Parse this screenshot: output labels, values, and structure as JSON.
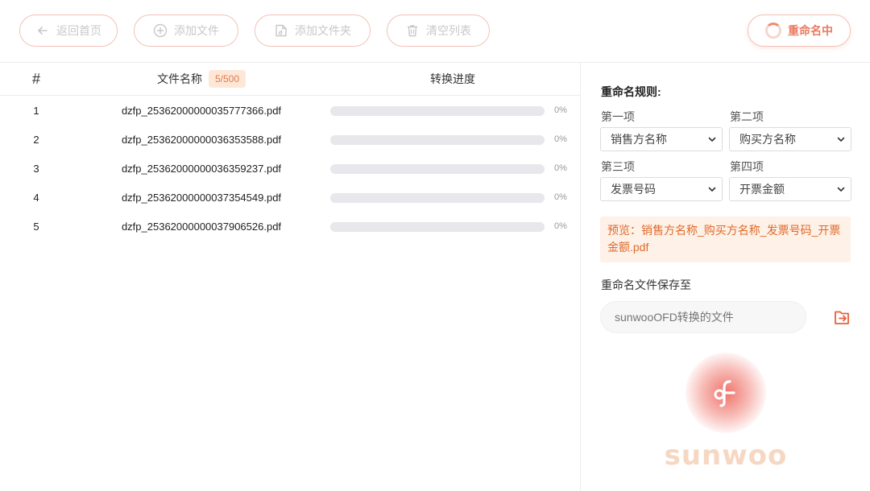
{
  "toolbar": {
    "back_label": "返回首页",
    "add_file_label": "添加文件",
    "add_folder_label": "添加文件夹",
    "clear_label": "清空列表",
    "rename_label": "重命名中"
  },
  "table": {
    "col_index": "#",
    "col_name": "文件名称",
    "count_badge": "5/500",
    "col_progress": "转换进度",
    "rows": [
      {
        "index": "1",
        "name": "dzfp_25362000000035777366.pdf",
        "progress": 0,
        "progress_text": "0%"
      },
      {
        "index": "2",
        "name": "dzfp_25362000000036353588.pdf",
        "progress": 0,
        "progress_text": "0%"
      },
      {
        "index": "3",
        "name": "dzfp_25362000000036359237.pdf",
        "progress": 0,
        "progress_text": "0%"
      },
      {
        "index": "4",
        "name": "dzfp_25362000000037354549.pdf",
        "progress": 0,
        "progress_text": "0%"
      },
      {
        "index": "5",
        "name": "dzfp_25362000000037906526.pdf",
        "progress": 0,
        "progress_text": "0%"
      }
    ]
  },
  "rules": {
    "title": "重命名规则:",
    "item1_label": "第一项",
    "item1_value": "销售方名称",
    "item2_label": "第二项",
    "item2_value": "购买方名称",
    "item3_label": "第三项",
    "item3_value": "发票号码",
    "item4_label": "第四项",
    "item4_value": "开票金额",
    "preview": "预览：销售方名称_购买方名称_发票号码_开票金额.pdf"
  },
  "save": {
    "label": "重命名文件保存至",
    "placeholder": "sunwooOFD转换的文件"
  },
  "brand": {
    "logo_text": "sunwoo"
  },
  "colors": {
    "accent": "#ea7a5f",
    "preview_bg": "#fdf1e8",
    "preview_text": "#e06a2a",
    "badge_bg": "#fde8d8",
    "progress_track": "#e7e7ec"
  }
}
